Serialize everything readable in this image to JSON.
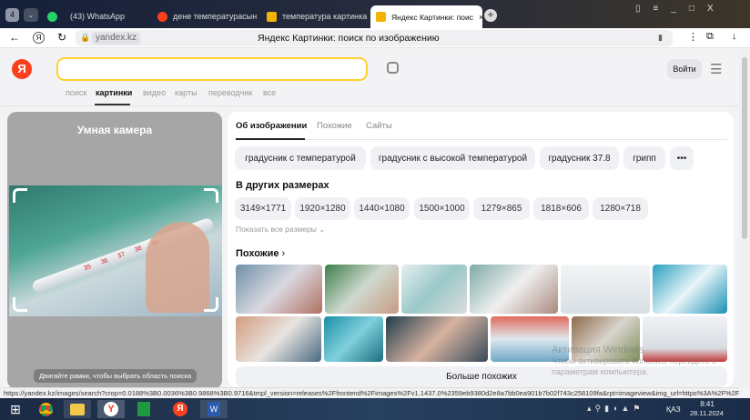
{
  "browser": {
    "tabs": [
      {
        "label": "4"
      },
      {
        "label": "(43) WhatsApp"
      },
      {
        "label": "дене температурасын ре"
      },
      {
        "label": "температура картинка: 2"
      },
      {
        "label": "Яндекс Картинки: поис"
      }
    ],
    "address": {
      "domain": "yandex.kz",
      "title": "Яндекс Картинки: поиск по изображению"
    }
  },
  "header": {
    "logo": "Я",
    "search_value": "",
    "login": "Войти",
    "nav": [
      "поиск",
      "картинки",
      "видео",
      "карты",
      "переводчик",
      "все"
    ],
    "active_nav": "картинки"
  },
  "left": {
    "title": "Умная камера",
    "hint": "Двигайте рамки, чтобы выбрать область поиска",
    "thermo_marks": [
      "35",
      "36",
      "37",
      "38",
      "40"
    ]
  },
  "card": {
    "tabs": [
      "Об изображении",
      "Похожие",
      "Сайты"
    ],
    "chips": [
      "градусник с температурой",
      "градусник с высокой температурой",
      "градусник 37.8",
      "грипп",
      "•••"
    ],
    "sizes_title": "В других размерах",
    "sizes": [
      "3149×1771",
      "1920×1280",
      "1440×1080",
      "1500×1000",
      "1279×865",
      "1818×606",
      "1280×718"
    ],
    "show_all": "Показать все размеры",
    "similar_title": "Похожие",
    "more": "Больше похожих"
  },
  "watermark": {
    "line1": "Активация Windows",
    "line2": "Чтобы активировать Windows, перейдите к",
    "line3": "параметрам компьютера."
  },
  "status_url": "https://yandex.kz/images/search?crop=0.0188%3B0.0036%3B0.9868%3B0.9716&tmpl_version=releases%2Ffrontend%2Fimages%2Fv1.1437.0%2359eb9380d2e8a7bb0ea901b7b02f743c258109fa&rpt=imageview&img_url=https%3A%2F%2Fww...",
  "taskbar": {
    "lang": "ҚАЗ",
    "time": "8:41",
    "date": "28.11.2024"
  },
  "colors": {
    "accent": "#ffd22e",
    "yandex_red": "#fc3f1d"
  }
}
